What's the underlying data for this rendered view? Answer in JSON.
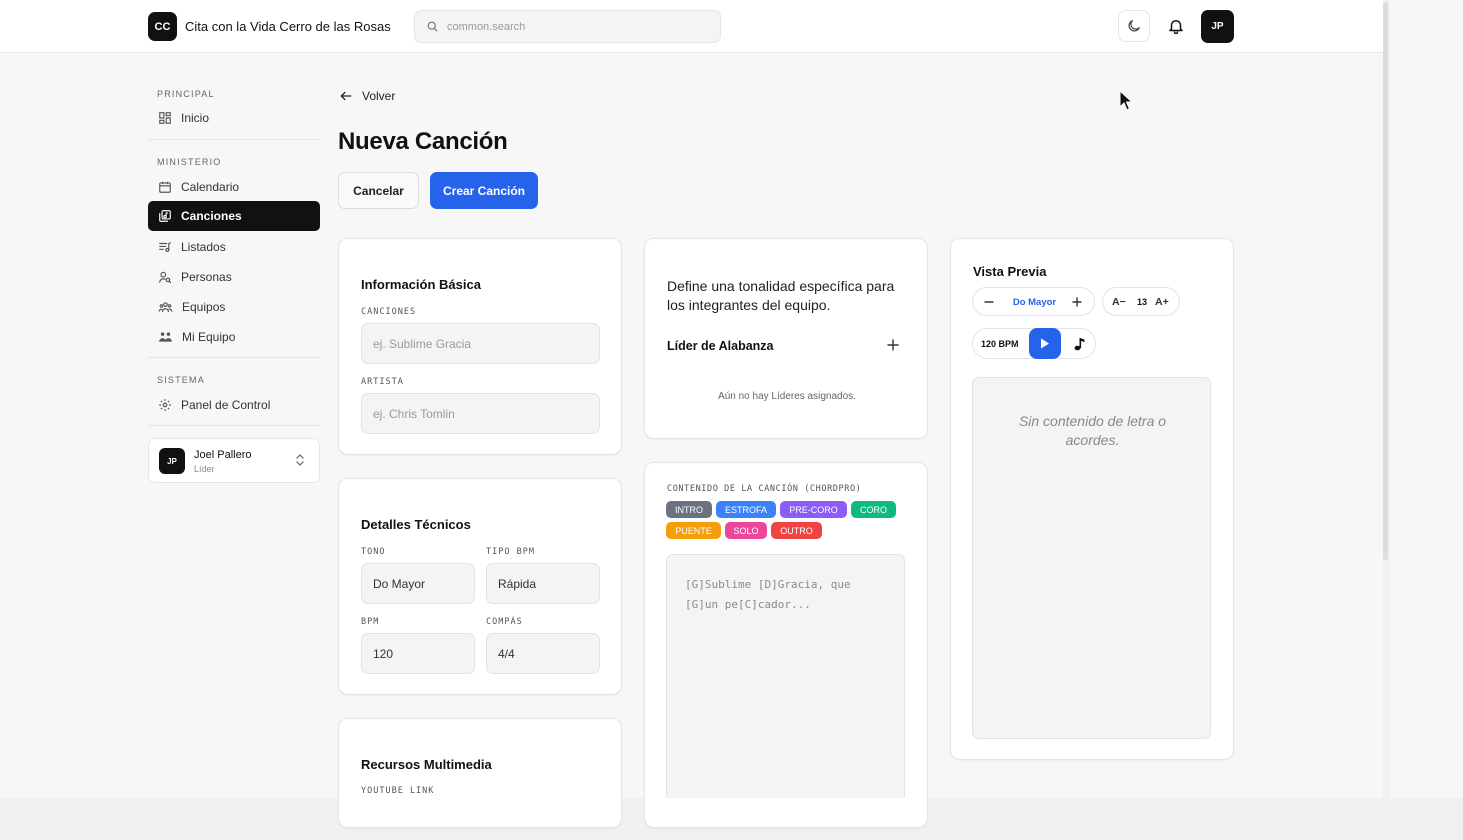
{
  "header": {
    "logo_initials": "CC",
    "app_title": "Cita con la Vida Cerro de las Rosas",
    "search_placeholder": "common.search",
    "avatar_initials": "JP"
  },
  "sidebar": {
    "sections": [
      {
        "label": "PRINCIPAL",
        "items": [
          {
            "label": "Inicio",
            "icon": "dashboard-icon"
          }
        ]
      },
      {
        "label": "MINISTERIO",
        "items": [
          {
            "label": "Calendario",
            "icon": "calendar-icon"
          },
          {
            "label": "Canciones",
            "icon": "songs-icon",
            "active": true
          },
          {
            "label": "Listados",
            "icon": "playlist-icon"
          },
          {
            "label": "Personas",
            "icon": "people-search-icon"
          },
          {
            "label": "Equipos",
            "icon": "teams-icon"
          },
          {
            "label": "Mi Equipo",
            "icon": "my-team-icon"
          }
        ]
      },
      {
        "label": "SISTEMA",
        "items": [
          {
            "label": "Panel de Control",
            "icon": "gear-icon"
          }
        ]
      }
    ],
    "user": {
      "initials": "JP",
      "name": "Joel Pallero",
      "role": "Líder"
    }
  },
  "main": {
    "back_label": "Volver",
    "title": "Nueva Canción",
    "cancel_label": "Cancelar",
    "create_label": "Crear Canción",
    "basic_info": {
      "title": "Información Básica",
      "song_label": "CANCIONES",
      "song_placeholder": "ej. Sublime Gracia",
      "artist_label": "ARTISTA",
      "artist_placeholder": "ej. Chris Tomlin"
    },
    "technical": {
      "title": "Detalles Técnicos",
      "key_label": "TONO",
      "key_value": "Do Mayor",
      "bpm_type_label": "TIPO BPM",
      "bpm_type_value": "Rápida",
      "bpm_label": "BPM",
      "bpm_value": "120",
      "time_label": "COMPÁS",
      "time_value": "4/4"
    },
    "media": {
      "title": "Recursos Multimedia",
      "youtube_label": "YOUTUBE LINK"
    },
    "leaders": {
      "description": "Define una tonalidad específica para los integrantes del equipo.",
      "role": "Líder de Alabanza",
      "empty": "Aún no hay Líderes asignados."
    },
    "content": {
      "label": "CONTENIDO DE LA CANCIÓN (CHORDPRO)",
      "tags": [
        {
          "label": "INTRO",
          "color": "#6b7280"
        },
        {
          "label": "ESTROFA",
          "color": "#3b82f6"
        },
        {
          "label": "PRE-CORO",
          "color": "#8b5cf6"
        },
        {
          "label": "CORO",
          "color": "#10b981"
        },
        {
          "label": "PUENTE",
          "color": "#f59e0b"
        },
        {
          "label": "SOLO",
          "color": "#ec4899"
        },
        {
          "label": "OUTRO",
          "color": "#ef4444"
        }
      ],
      "placeholder_line1": "[G]Sublime [D]Gracia, que",
      "placeholder_line2": "[G]un pe[C]cador..."
    },
    "preview": {
      "title": "Vista Previa",
      "key": "Do Mayor",
      "font_decrease": "A−",
      "font_size": "13",
      "font_increase": "A+",
      "bpm": "120 BPM",
      "empty": "Sin contenido de letra o acordes."
    }
  },
  "colors": {
    "accent": "#2563eb",
    "dark": "#111111"
  }
}
